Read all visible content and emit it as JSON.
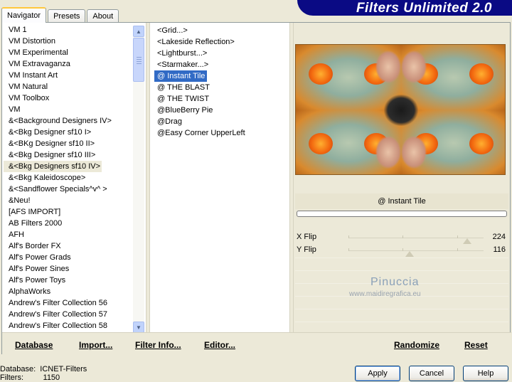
{
  "tabs": [
    {
      "label": "Navigator",
      "active": true
    },
    {
      "label": "Presets",
      "active": false
    },
    {
      "label": "About",
      "active": false
    }
  ],
  "banner": {
    "title": "Filters Unlimited 2.0",
    "color": "#0a0a84"
  },
  "categories": [
    "VM 1",
    "VM Distortion",
    "VM Experimental",
    "VM Extravaganza",
    "VM Instant Art",
    "VM Natural",
    "VM Toolbox",
    "VM",
    "&<Background Designers IV>",
    "&<Bkg Designer sf10 I>",
    "&<BKg Designer sf10 II>",
    "&<Bkg Designer sf10 III>",
    "&<Bkg Designers sf10 IV>",
    "&<Bkg Kaleidoscope>",
    "&<Sandflower Specials^v^ >",
    "&Neu!",
    "[AFS IMPORT]",
    "AB Filters 2000",
    "AFH",
    "Alf's Border FX",
    "Alf's Power Grads",
    "Alf's Power Sines",
    "Alf's Power Toys",
    "AlphaWorks",
    "Andrew's Filter Collection 56",
    "Andrew's Filter Collection 57",
    "Andrew's Filter Collection 58"
  ],
  "selected_category_index": 12,
  "filters": [
    "<Grid...>",
    "<Lakeside Reflection>",
    "<Lightburst...>",
    "<Starmaker...>",
    "@ Instant Tile",
    "@ THE BLAST",
    "@ THE TWIST",
    "@BlueBerry Pie",
    "@Drag",
    "@Easy Corner UpperLeft"
  ],
  "selected_filter_index": 4,
  "selected_filter_name": "@ Instant Tile",
  "params": [
    {
      "label": "X Flip",
      "value": "224",
      "fraction": 0.878
    },
    {
      "label": "Y Flip",
      "value": "116",
      "fraction": 0.455
    }
  ],
  "watermark": {
    "line1": "Pinuccia",
    "line2": "www.maidiregrafica.eu"
  },
  "bottom_links": {
    "database": "Database",
    "import": "Import...",
    "filter_info": "Filter Info...",
    "editor": "Editor...",
    "randomize": "Randomize",
    "reset": "Reset"
  },
  "status": {
    "database_label": "Database:",
    "database_value": "ICNET-Filters",
    "filters_label": "Filters:",
    "filters_value": "1150"
  },
  "buttons": {
    "apply": "Apply",
    "cancel": "Cancel",
    "help": "Help"
  },
  "selection_color": "#316ac5"
}
